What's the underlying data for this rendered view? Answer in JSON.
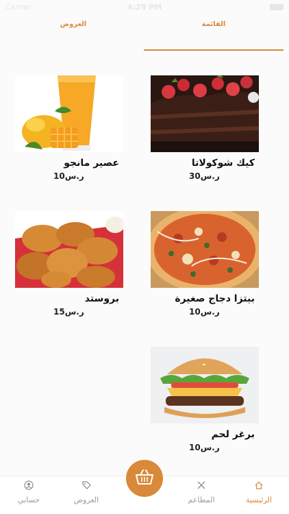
{
  "status": {
    "carrier": "Carrier",
    "time": "4:29 PM"
  },
  "tabs": {
    "menu": "القائمة",
    "offers": "العروض"
  },
  "products": [
    {
      "name": "كيك شوكولاتا",
      "price": "30ر.س",
      "icon": "chocolate-cake"
    },
    {
      "name": "عصير مانجو",
      "price": "10ر.س",
      "icon": "mango-juice"
    },
    {
      "name": "بيتزا دجاج صغيرة",
      "price": "10ر.س",
      "icon": "chicken-pizza"
    },
    {
      "name": "بروستد",
      "price": "15ر.س",
      "icon": "fried-chicken"
    },
    {
      "name": "برغر لحم",
      "price": "10ر.س",
      "icon": "beef-burger"
    }
  ],
  "nav": {
    "home": "الرئيسية",
    "restaurants": "المطاعم",
    "offers": "العروض",
    "account": "حسابي"
  },
  "colors": {
    "accent": "#d9893a",
    "inactive": "#9a9a9a"
  }
}
